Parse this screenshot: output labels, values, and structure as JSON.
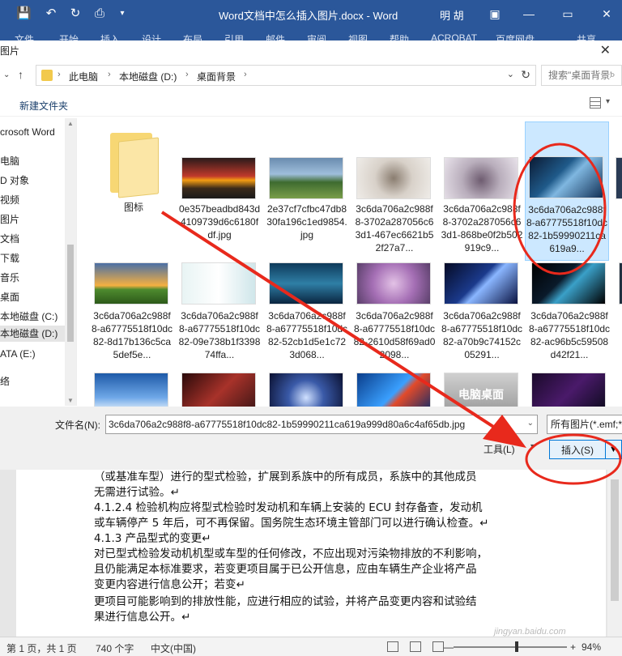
{
  "titlebar": {
    "doc_title": "Word文档中怎么插入图片.docx  -  Word",
    "user": "明 胡",
    "minimize": "—",
    "restore": "▭",
    "close": "✕"
  },
  "ribbon": {
    "tabs": [
      "文件",
      "开始",
      "插入",
      "设计",
      "布局",
      "引用",
      "邮件",
      "审阅",
      "视图",
      "帮助",
      "ACROBAT",
      "百度网盘",
      "共享"
    ]
  },
  "dialog": {
    "title": "图片",
    "breadcrumb": [
      "此电脑",
      "本地磁盘 (D:)",
      "桌面背景"
    ],
    "search_placeholder": "搜索\"桌面背景\"",
    "new_folder": "新建文件夹",
    "nav_items": [
      {
        "label": "crosoft Word",
        "selected": false
      },
      {
        "label": "电脑",
        "selected": false
      },
      {
        "label": "D 对象",
        "selected": false
      },
      {
        "label": "视频",
        "selected": false
      },
      {
        "label": "图片",
        "selected": false
      },
      {
        "label": "文档",
        "selected": false
      },
      {
        "label": "下载",
        "selected": false
      },
      {
        "label": "音乐",
        "selected": false
      },
      {
        "label": "桌面",
        "selected": false
      },
      {
        "label": "本地磁盘 (C:)",
        "selected": false
      },
      {
        "label": "本地磁盘 (D:)",
        "selected": true
      },
      {
        "label": "ATA (E:)",
        "selected": false
      },
      {
        "label": "络",
        "selected": false
      }
    ],
    "files": [
      {
        "name": "图标",
        "type": "folder"
      },
      {
        "name": "0e357beadbd843d4109739d6c6180fdf.jpg",
        "type": "image"
      },
      {
        "name": "2e37cf7cfbc47db830fa196c1ed9854.jpg",
        "type": "image"
      },
      {
        "name": "3c6da706a2c988f8-3702a287056c63d1-467ec6621b52f27a7...",
        "type": "image"
      },
      {
        "name": "3c6da706a2c988f8-3702a287056c63d1-868be0f2b502919c9...",
        "type": "image"
      },
      {
        "name": "3c6da706a2c988f8-a67775518f10dc82-1b59990211ca619a9...",
        "type": "image",
        "selected": true
      },
      {
        "name": "3c6da706a2c988f8-a67775518f10dc82-8d17b136c5ca5def5e...",
        "type": "image"
      },
      {
        "name": "3c6da706a2c988f8-a67775518f10dc82-09e738b1f339874ffa...",
        "type": "image"
      },
      {
        "name": "3c6da706a2c988f8-a67775518f10dc82-52cb1d5e1c723d068...",
        "type": "image"
      },
      {
        "name": "3c6da706a2c988f8-a67775518f10dc82-2610d58f69ad02098...",
        "type": "image"
      },
      {
        "name": "3c6da706a2c988f8-a67775518f10dc82-a70b9c74152c05291...",
        "type": "image"
      },
      {
        "name": "3c6da706a2c988f8-a67775518f10dc82-ac96b5c59508d42f21...",
        "type": "image"
      },
      {
        "name": "",
        "type": "image"
      },
      {
        "name": "",
        "type": "image"
      },
      {
        "name": "",
        "type": "image"
      },
      {
        "name": "",
        "type": "image"
      },
      {
        "name": "电脑桌面",
        "type": "image"
      },
      {
        "name": "",
        "type": "image"
      }
    ],
    "filename_label": "文件名(N):",
    "filename_value": "3c6da706a2c988f8-a67775518f10dc82-1b59990211ca619a999d80a6c4af65db.jpg",
    "filetype": "所有图片(*.emf;*",
    "tools_label": "工具(L)",
    "insert_label": "插入(S)"
  },
  "document": {
    "lines": [
      "（或基准车型）进行的型式检验，扩展到系族中的所有成员，系族中的其他成员",
      "无需进行试验。↵",
      "4.1.2.4 检验机构应将型式检验时发动机和车辆上安装的 ECU 封存备查，发动机",
      "或车辆停产 5 年后，可不再保留。国务院生态环境主管部门可以进行确认检查。↵",
      "4.1.3 产品型式的变更↵",
      "对已型式检验发动机机型或车型的任何修改，不应出现对污染物排放的不利影响，",
      "且仍能满足本标准要求，若变更项目属于已公开信息，应由车辆生产企业将产品",
      "变更内容进行信息公开；若变↵",
      "更项目可能影响到的排放性能，应进行相应的试验，并将产品变更内容和试验结",
      "果进行信息公开。↵"
    ]
  },
  "statusbar": {
    "page": "第 1 页，共 1 页",
    "words": "740 个字",
    "language": "中文(中国)",
    "zoom": "94%",
    "minus": "—",
    "plus": "+"
  },
  "watermark": "jingyan.baidu.com",
  "colors": {
    "word_blue": "#2b579a",
    "annotation_red": "#e8291c",
    "selection": "#cce8ff"
  }
}
